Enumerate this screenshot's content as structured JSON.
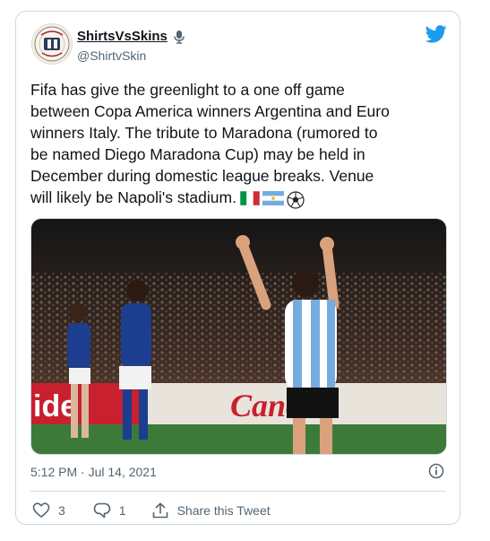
{
  "author": {
    "display_name": "ShirtsVsSkins",
    "handle": "@ShirtvSkin",
    "avatar_text": "SHIRTS VS SKINS"
  },
  "tweet": {
    "text": "Fifa has give the greenlight to a one off game\nbetween Copa America winners Argentina and Euro\nwinners Italy. The tribute to Maradona (rumored to\nbe named Diego Maradona Cup) may be held in\nDecember during domestic league breaks. Venue\nwill likely be Napoli's stadium.",
    "emojis": [
      "italy-flag-icon",
      "argentina-flag-icon",
      "soccer-ball-icon"
    ],
    "ad_board_left": "ide",
    "ad_board_right": "Canon"
  },
  "meta": {
    "timestamp": "5:12 PM · Jul 14, 2021"
  },
  "actions": {
    "likes": "3",
    "replies": "1",
    "share_label": "Share this Tweet"
  },
  "colors": {
    "twitter_blue": "#1d9bf0",
    "muted": "#536471",
    "border": "#cfd9de"
  }
}
